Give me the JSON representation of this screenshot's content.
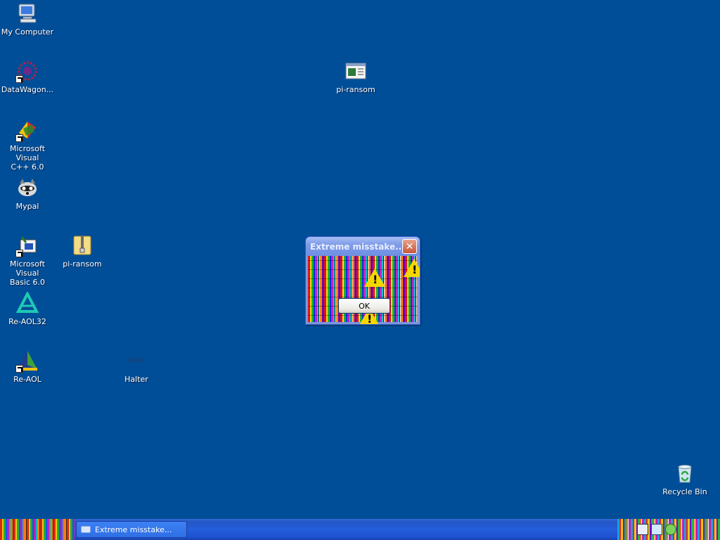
{
  "desktop": {
    "background_color": "#004e98",
    "icons": [
      {
        "label": "My Computer",
        "icon": "my-computer-icon"
      },
      {
        "label": "DataWagon...",
        "icon": "datawagon-icon"
      },
      {
        "label": "Microsoft Visual\nC++ 6.0",
        "icon": "visual-cpp-icon"
      },
      {
        "label": "Mypal",
        "icon": "mypal-raccoon-icon"
      },
      {
        "label": "Microsoft Visual\nBasic 6.0",
        "icon": "visual-basic-icon"
      },
      {
        "label": "pi-ransom",
        "icon": "zip-folder-icon"
      },
      {
        "label": "Re-AOL32",
        "icon": "aol-triangle-icon"
      },
      {
        "label": "Re-AOL",
        "icon": "aol-pyramid-icon"
      },
      {
        "label": "pi-ransom",
        "icon": "application-window-icon"
      },
      {
        "label": "Halter",
        "icon": "halter-text-icon",
        "icon_text": "halter"
      },
      {
        "label": "Recycle Bin",
        "icon": "recycle-bin-icon"
      }
    ]
  },
  "dialog": {
    "title": "Extreme misstake...",
    "ok_label": "OK",
    "close_glyph": "✕"
  },
  "taskbar": {
    "task_button_label": "Extreme misstake...",
    "tray_icons": [
      "keyboard-icon",
      "network-icon",
      "recycle-tray-icon"
    ]
  }
}
